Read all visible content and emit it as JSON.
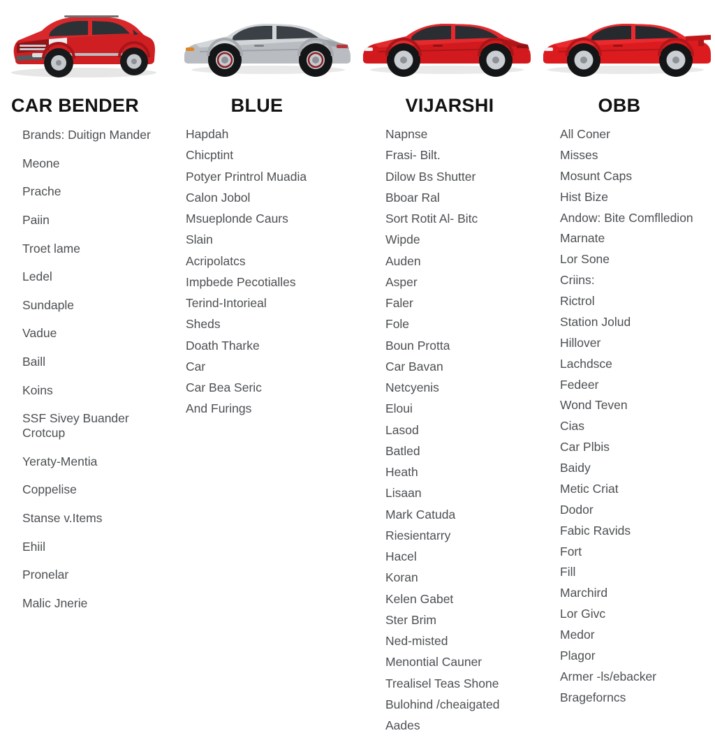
{
  "gallery": {
    "items": [
      {
        "name": "red-suv-photo",
        "alt": "Red SUV three-quarter front view",
        "body_color": "#cf1f22",
        "glass_color": "#2c3136",
        "type": "suv"
      },
      {
        "name": "silver-coupe-photo",
        "alt": "Silver sports coupe side view",
        "body_color": "#b9bcc0",
        "glass_color": "#3a4046",
        "type": "coupe"
      },
      {
        "name": "red-coupe-photo",
        "alt": "Red sports coupe side view",
        "body_color": "#d21a1e",
        "glass_color": "#2a2d31",
        "type": "coupe"
      },
      {
        "name": "red-sports-car-photo",
        "alt": "Red sports car side view with spoiler",
        "body_color": "#dc1b1f",
        "glass_color": "#26292d",
        "type": "coupe"
      }
    ]
  },
  "columns": [
    {
      "title": "CAR BENDER",
      "items": [
        "Brands: Duitign Mander",
        "Meone",
        "Prache",
        "Paiin",
        "Troet lame",
        "Ledel",
        "Sundaple",
        "Vadue",
        "Baill",
        "Koins",
        "SSF Sivey Buander Crotcup",
        "Yeraty-Mentia",
        "Coppelise",
        "Stanse v.Items",
        "Ehiil",
        "Pronelar",
        "Malic Jnerie"
      ]
    },
    {
      "title": "BLUE",
      "items": [
        "Hapdah",
        "Chicptint",
        "Potyer Printrol Muadia",
        "Calon Jobol",
        "Msueplonde Caurs",
        "Slain",
        "Acripolatcs",
        "Impbede Pecotialles",
        "Terind-Intorieal",
        "Sheds",
        "Doath Tharke",
        "Car",
        "Car Bea Seric",
        "And Furings"
      ]
    },
    {
      "title": "VIJARSHI",
      "items": [
        "Napnse",
        "Frasi- Bilt.",
        "Dilow Bs Shutter",
        "Bboar Ral",
        "Sort Rotit Al- Bitc",
        "Wipde",
        "Auden",
        "Asper",
        "Faler",
        "Fole",
        "Boun Protta",
        "Car Bavan",
        "Netcyenis",
        "Eloui",
        "Lasod",
        "Batled",
        "Heath",
        "Lisaan",
        "Mark Catuda",
        "Riesientarry",
        "Hacel",
        "Koran",
        "Kelen Gabet",
        "Ster Brim",
        "Ned-misted",
        "Menontial Cauner",
        "Trealisel Teas Shone",
        "Bulohind /cheaigated",
        "Aades"
      ]
    },
    {
      "title": "OBB",
      "items": [
        "All Coner",
        "Misses",
        "Mosunt Caps",
        "Hist Bize",
        "Andow: Bite Comflledion",
        "Marnate",
        "Lor Sone",
        "Criins:",
        "Rictrol",
        "Station Jolud",
        "Hillover",
        "Lachdsce",
        "Fedeer",
        "Wond Teven",
        "Cias",
        "Car Plbis",
        "Baidy",
        "Metic Criat",
        "Dodor",
        "Fabic Ravids",
        "Fort",
        "Fill",
        "Marchird",
        "Lor Givc",
        "Medor",
        "Plagor",
        "Armer -ls/ebacker",
        "Brageforncs"
      ]
    }
  ],
  "colors": {
    "background": "#ffffff",
    "heading_text": "#121212",
    "list_text": "#4c4f52"
  }
}
